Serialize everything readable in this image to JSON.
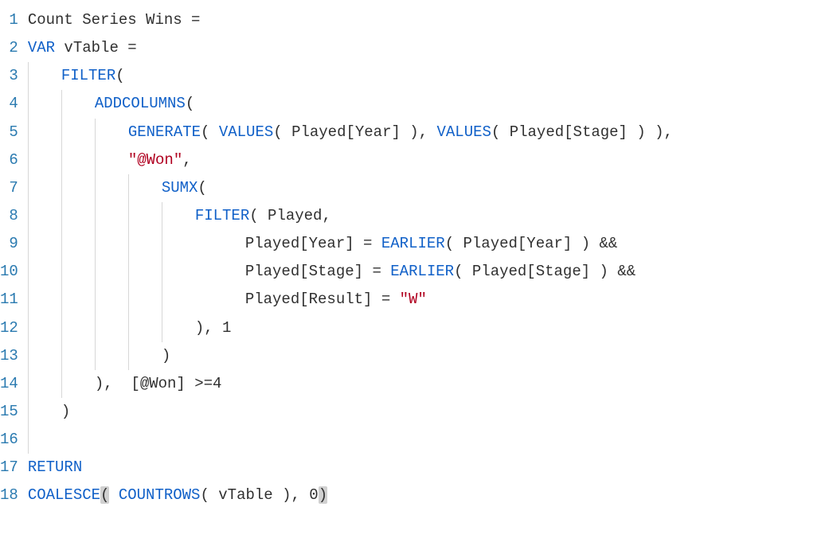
{
  "editor": {
    "language": "DAX",
    "lines": [
      {
        "n": 1,
        "indent": 0,
        "guides": [],
        "tokens": [
          {
            "t": "Count Series Wins ",
            "c": "plain"
          },
          {
            "t": "=",
            "c": "op"
          }
        ]
      },
      {
        "n": 2,
        "indent": 0,
        "guides": [],
        "tokens": [
          {
            "t": "VAR",
            "c": "kw"
          },
          {
            "t": " vTable ",
            "c": "plain"
          },
          {
            "t": "=",
            "c": "op"
          }
        ]
      },
      {
        "n": 3,
        "indent": 4,
        "guides": [
          0
        ],
        "tokens": [
          {
            "t": "FILTER",
            "c": "fn"
          },
          {
            "t": "(",
            "c": "op"
          }
        ]
      },
      {
        "n": 4,
        "indent": 8,
        "guides": [
          0,
          4
        ],
        "tokens": [
          {
            "t": "ADDCOLUMNS",
            "c": "fn"
          },
          {
            "t": "(",
            "c": "op"
          }
        ]
      },
      {
        "n": 5,
        "indent": 12,
        "guides": [
          0,
          4,
          8
        ],
        "tokens": [
          {
            "t": "GENERATE",
            "c": "fn"
          },
          {
            "t": "( ",
            "c": "op"
          },
          {
            "t": "VALUES",
            "c": "fn"
          },
          {
            "t": "( Played[Year] ), ",
            "c": "plain"
          },
          {
            "t": "VALUES",
            "c": "fn"
          },
          {
            "t": "( Played[Stage] ) ),",
            "c": "plain"
          }
        ]
      },
      {
        "n": 6,
        "indent": 12,
        "guides": [
          0,
          4,
          8
        ],
        "tokens": [
          {
            "t": "\"@Won\"",
            "c": "str"
          },
          {
            "t": ",",
            "c": "op"
          }
        ]
      },
      {
        "n": 7,
        "indent": 16,
        "guides": [
          0,
          4,
          8,
          12
        ],
        "tokens": [
          {
            "t": "SUMX",
            "c": "fn"
          },
          {
            "t": "(",
            "c": "op"
          }
        ]
      },
      {
        "n": 8,
        "indent": 20,
        "guides": [
          0,
          4,
          8,
          12,
          16
        ],
        "tokens": [
          {
            "t": "FILTER",
            "c": "fn"
          },
          {
            "t": "( Played,",
            "c": "plain"
          }
        ]
      },
      {
        "n": 9,
        "indent": 26,
        "guides": [
          0,
          4,
          8,
          12,
          16
        ],
        "tokens": [
          {
            "t": "Played[Year] ",
            "c": "plain"
          },
          {
            "t": "=",
            "c": "op"
          },
          {
            "t": " ",
            "c": "plain"
          },
          {
            "t": "EARLIER",
            "c": "fn"
          },
          {
            "t": "( Played[Year] ) &&",
            "c": "plain"
          }
        ]
      },
      {
        "n": 10,
        "indent": 26,
        "guides": [
          0,
          4,
          8,
          12,
          16
        ],
        "tokens": [
          {
            "t": "Played[Stage] ",
            "c": "plain"
          },
          {
            "t": "=",
            "c": "op"
          },
          {
            "t": " ",
            "c": "plain"
          },
          {
            "t": "EARLIER",
            "c": "fn"
          },
          {
            "t": "( Played[Stage] ) &&",
            "c": "plain"
          }
        ]
      },
      {
        "n": 11,
        "indent": 26,
        "guides": [
          0,
          4,
          8,
          12,
          16
        ],
        "tokens": [
          {
            "t": "Played[Result] ",
            "c": "plain"
          },
          {
            "t": "=",
            "c": "op"
          },
          {
            "t": " ",
            "c": "plain"
          },
          {
            "t": "\"W\"",
            "c": "str"
          }
        ]
      },
      {
        "n": 12,
        "indent": 20,
        "guides": [
          0,
          4,
          8,
          12,
          16
        ],
        "tokens": [
          {
            "t": "), ",
            "c": "plain"
          },
          {
            "t": "1",
            "c": "num"
          }
        ]
      },
      {
        "n": 13,
        "indent": 16,
        "guides": [
          0,
          4,
          8,
          12
        ],
        "tokens": [
          {
            "t": ")",
            "c": "op"
          }
        ]
      },
      {
        "n": 14,
        "indent": 8,
        "guides": [
          0,
          4
        ],
        "tokens": [
          {
            "t": "),  [@Won] ",
            "c": "plain"
          },
          {
            "t": ">=",
            "c": "op"
          },
          {
            "t": "4",
            "c": "num"
          }
        ]
      },
      {
        "n": 15,
        "indent": 4,
        "guides": [
          0
        ],
        "tokens": [
          {
            "t": ")",
            "c": "op"
          }
        ]
      },
      {
        "n": 16,
        "indent": 0,
        "guides": [
          0
        ],
        "tokens": []
      },
      {
        "n": 17,
        "indent": 0,
        "guides": [],
        "tokens": [
          {
            "t": "RETURN",
            "c": "kw"
          }
        ]
      },
      {
        "n": 18,
        "indent": 0,
        "guides": [],
        "tokens": [
          {
            "t": "COALESCE",
            "c": "fn"
          },
          {
            "t": "(",
            "c": "op",
            "hl": true
          },
          {
            "t": " ",
            "c": "plain"
          },
          {
            "t": "COUNTROWS",
            "c": "fn"
          },
          {
            "t": "( vTable ), ",
            "c": "plain"
          },
          {
            "t": "0",
            "c": "num"
          },
          {
            "t": ")",
            "c": "op",
            "hl": true
          }
        ]
      }
    ],
    "charWidthPx": 10.5
  }
}
